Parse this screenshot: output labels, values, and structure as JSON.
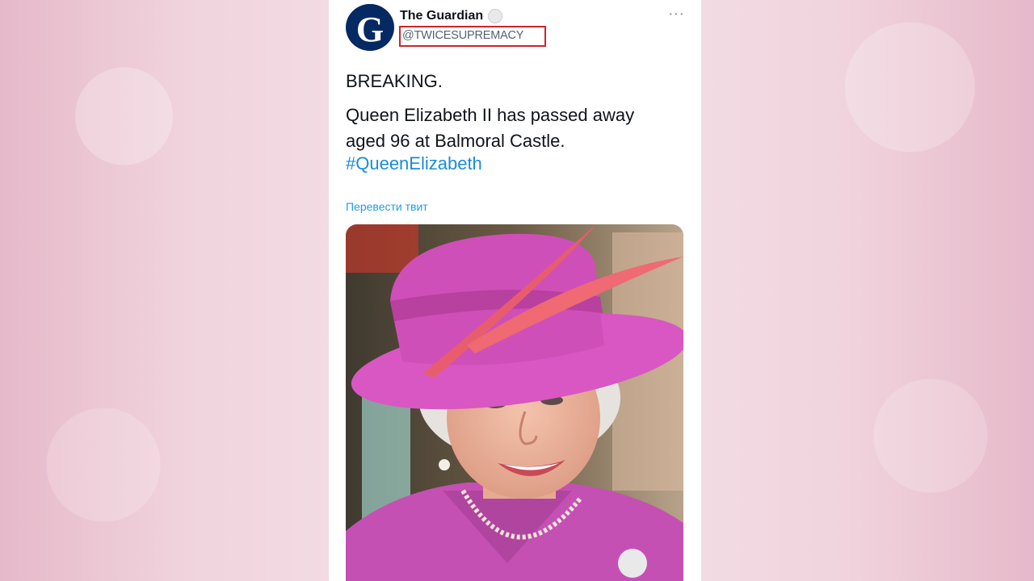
{
  "tweet": {
    "author_name": "The Guardian",
    "handle": "@TWICESUPREMACY",
    "avatar_letter": "G",
    "more_label": "···",
    "line1": "BREAKING.",
    "body": "Queen Elizabeth II has passed away aged 96 at Balmoral Castle.",
    "hashtag": "#QueenElizabeth",
    "translate_label": "Перевести твит"
  },
  "colors": {
    "hashtag": "#1d9bf0",
    "handle_highlight": "#d0232a",
    "avatar_bg": "#052962",
    "hat": "#d957c2"
  },
  "icons": {
    "verified": "verified-badge-icon",
    "more": "more-options-icon"
  }
}
